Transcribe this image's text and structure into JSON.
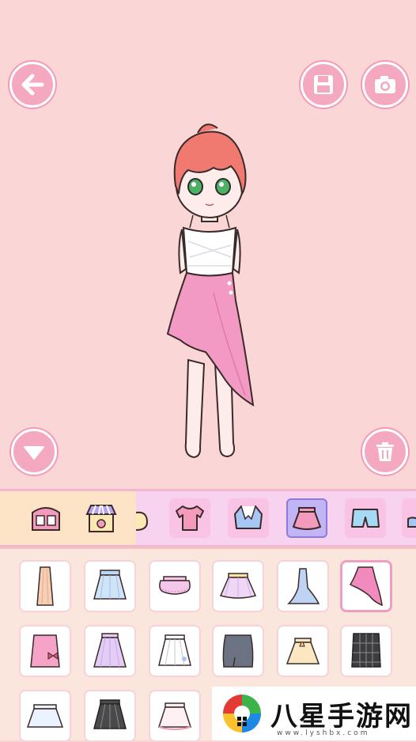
{
  "toolbar": {
    "back_icon": "arrow-left-icon",
    "save_icon": "save-icon",
    "camera_icon": "camera-icon",
    "collapse_icon": "triangle-down-icon",
    "delete_icon": "trash-icon"
  },
  "categories": [
    {
      "name": "wardrobe",
      "icon": "wardrobe-icon"
    },
    {
      "name": "shop",
      "icon": "shop-icon"
    },
    {
      "name": "hair",
      "icon": "hair-icon"
    },
    {
      "name": "tops",
      "icon": "tshirt-icon"
    },
    {
      "name": "jackets",
      "icon": "jacket-icon"
    },
    {
      "name": "skirts",
      "icon": "skirt-icon",
      "active": true
    },
    {
      "name": "shorts",
      "icon": "shorts-icon"
    },
    {
      "name": "shoes",
      "icon": "shoe-icon"
    }
  ],
  "items": [
    {
      "name": "peach-maxi-skirt",
      "color": "#f7cfb5"
    },
    {
      "name": "blue-pleated-skirt",
      "color": "#cfe4f7"
    },
    {
      "name": "pink-tutu",
      "color": "#f4c7ea"
    },
    {
      "name": "pastel-tutu",
      "color": "#f1d6f6"
    },
    {
      "name": "blue-mermaid-skirt",
      "color": "#bfd4f4"
    },
    {
      "name": "pink-ruffle-skirt",
      "color": "#f28bbd",
      "selected": true
    },
    {
      "name": "pink-bow-skirt",
      "color": "#f5a3c6"
    },
    {
      "name": "lavender-skirt",
      "color": "#e3cdf5"
    },
    {
      "name": "white-flower-skirt",
      "color": "#ffffff"
    },
    {
      "name": "grey-pencil-skirt",
      "color": "#6b7382"
    },
    {
      "name": "cream-skirt",
      "color": "#fbe7c0"
    },
    {
      "name": "plaid-skirt",
      "color": "#3d3d40"
    },
    {
      "name": "white-short-skirt",
      "color": "#eaf3ff"
    },
    {
      "name": "black-pleated-skirt",
      "color": "#4a4a4c"
    },
    {
      "name": "white-pink-skirt",
      "color": "#fff0f4"
    }
  ],
  "watermark": {
    "title": "八星手游网",
    "url": "www.lyshbx.com"
  }
}
